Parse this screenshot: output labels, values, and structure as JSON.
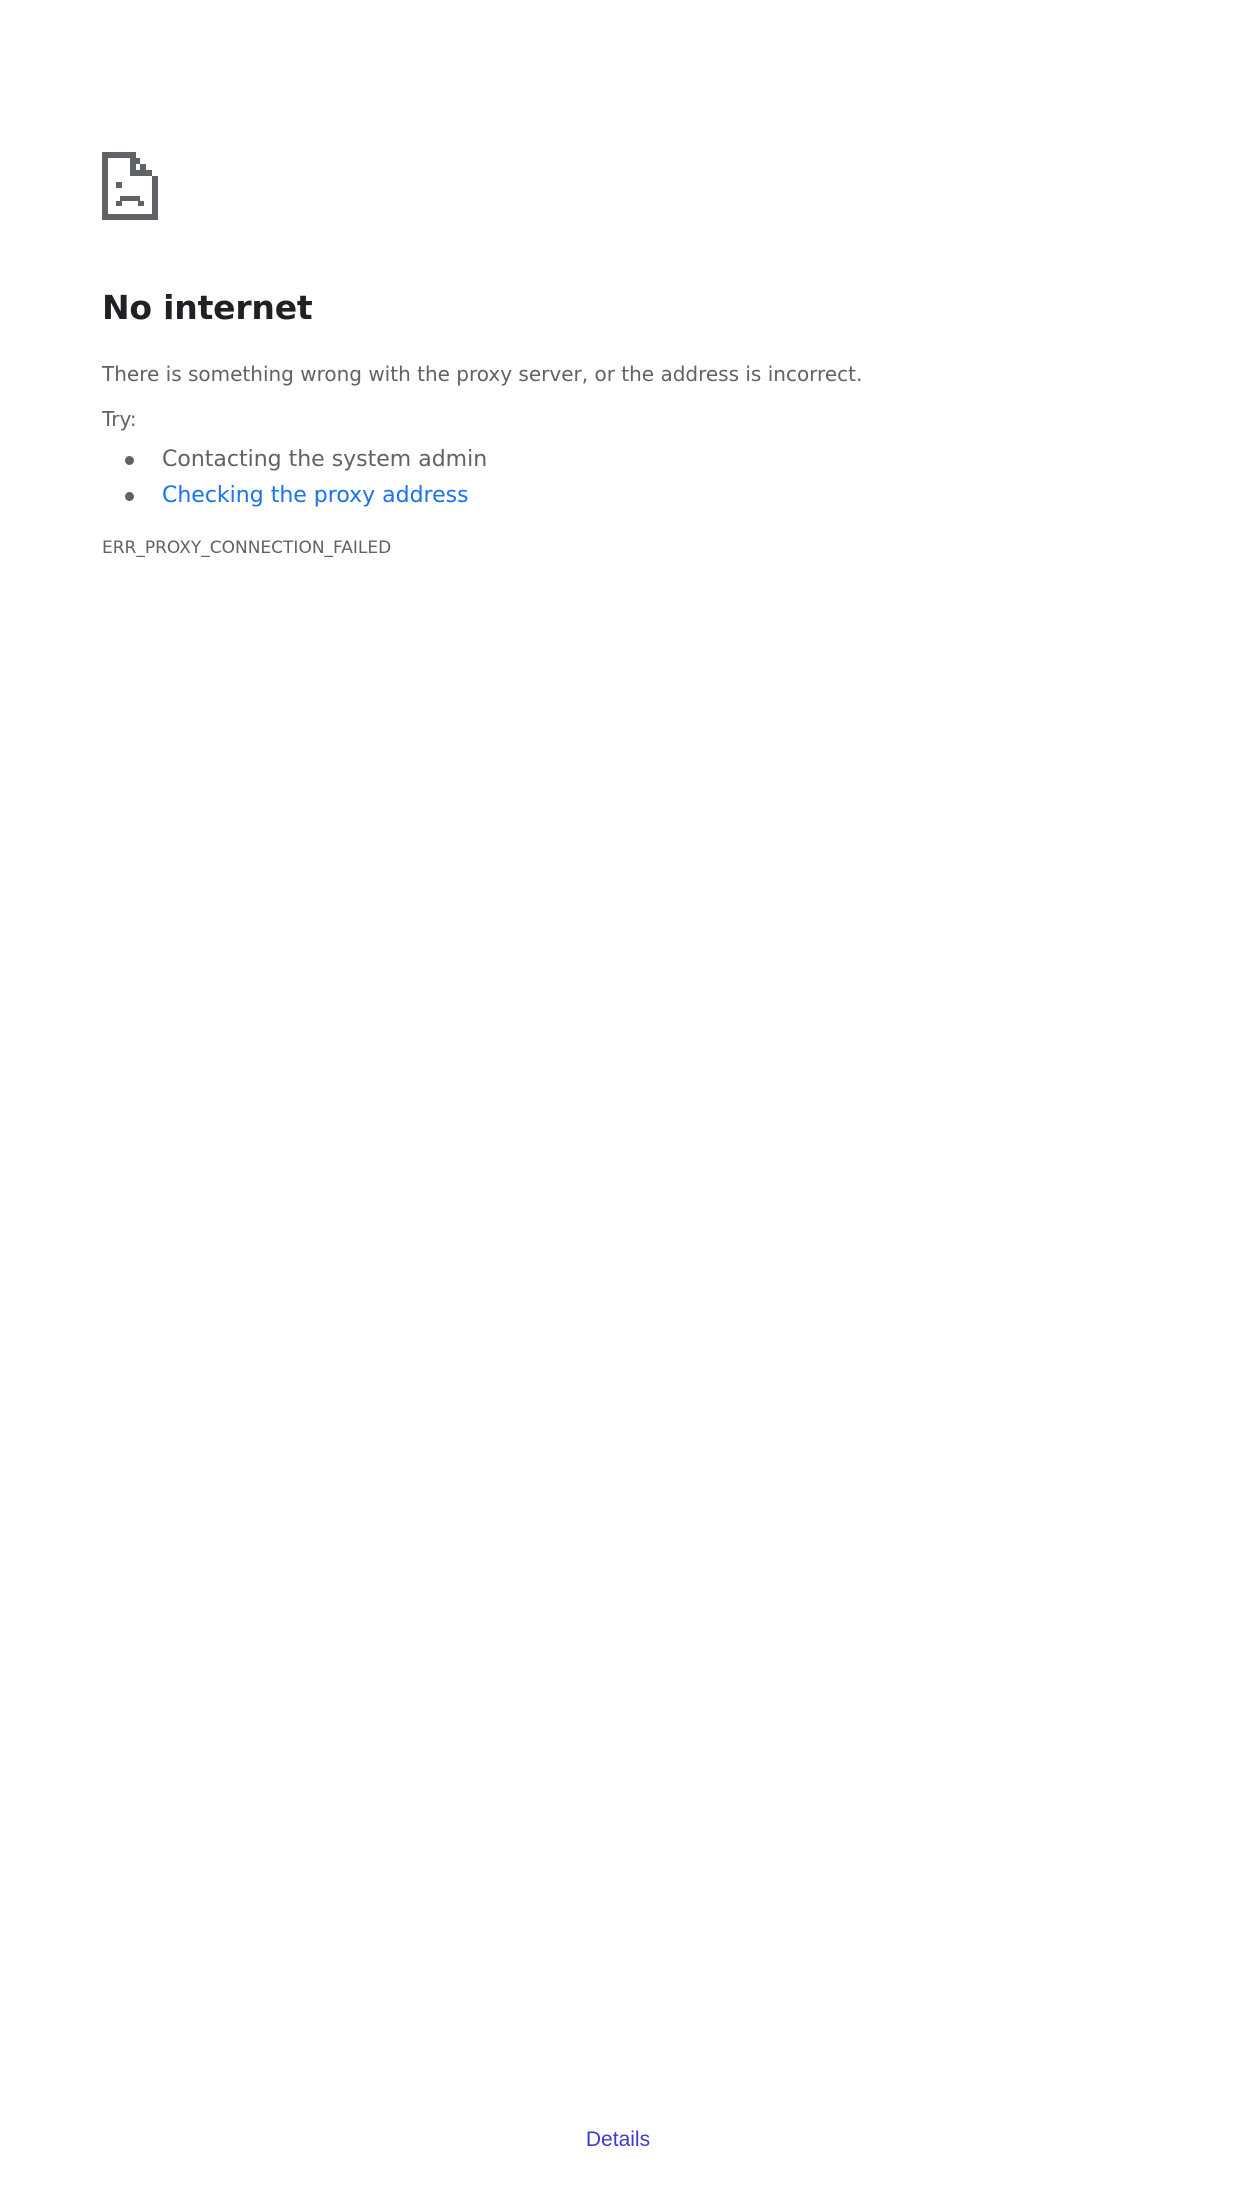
{
  "error_page": {
    "icon": "sad-page-icon",
    "title": "No internet",
    "description": "There is something wrong with the proxy server, or the address is incorrect.",
    "try_label": "Try:",
    "suggestions": [
      {
        "text": "Contacting the system admin",
        "is_link": false
      },
      {
        "text": "Checking the proxy address",
        "is_link": true
      }
    ],
    "error_code": "ERR_PROXY_CONNECTION_FAILED",
    "details_label": "Details"
  },
  "colors": {
    "heading": "#202124",
    "body_text": "#5f6368",
    "link": "#1a73e8",
    "details_link": "#3f3bd1",
    "icon": "#5f6368"
  }
}
